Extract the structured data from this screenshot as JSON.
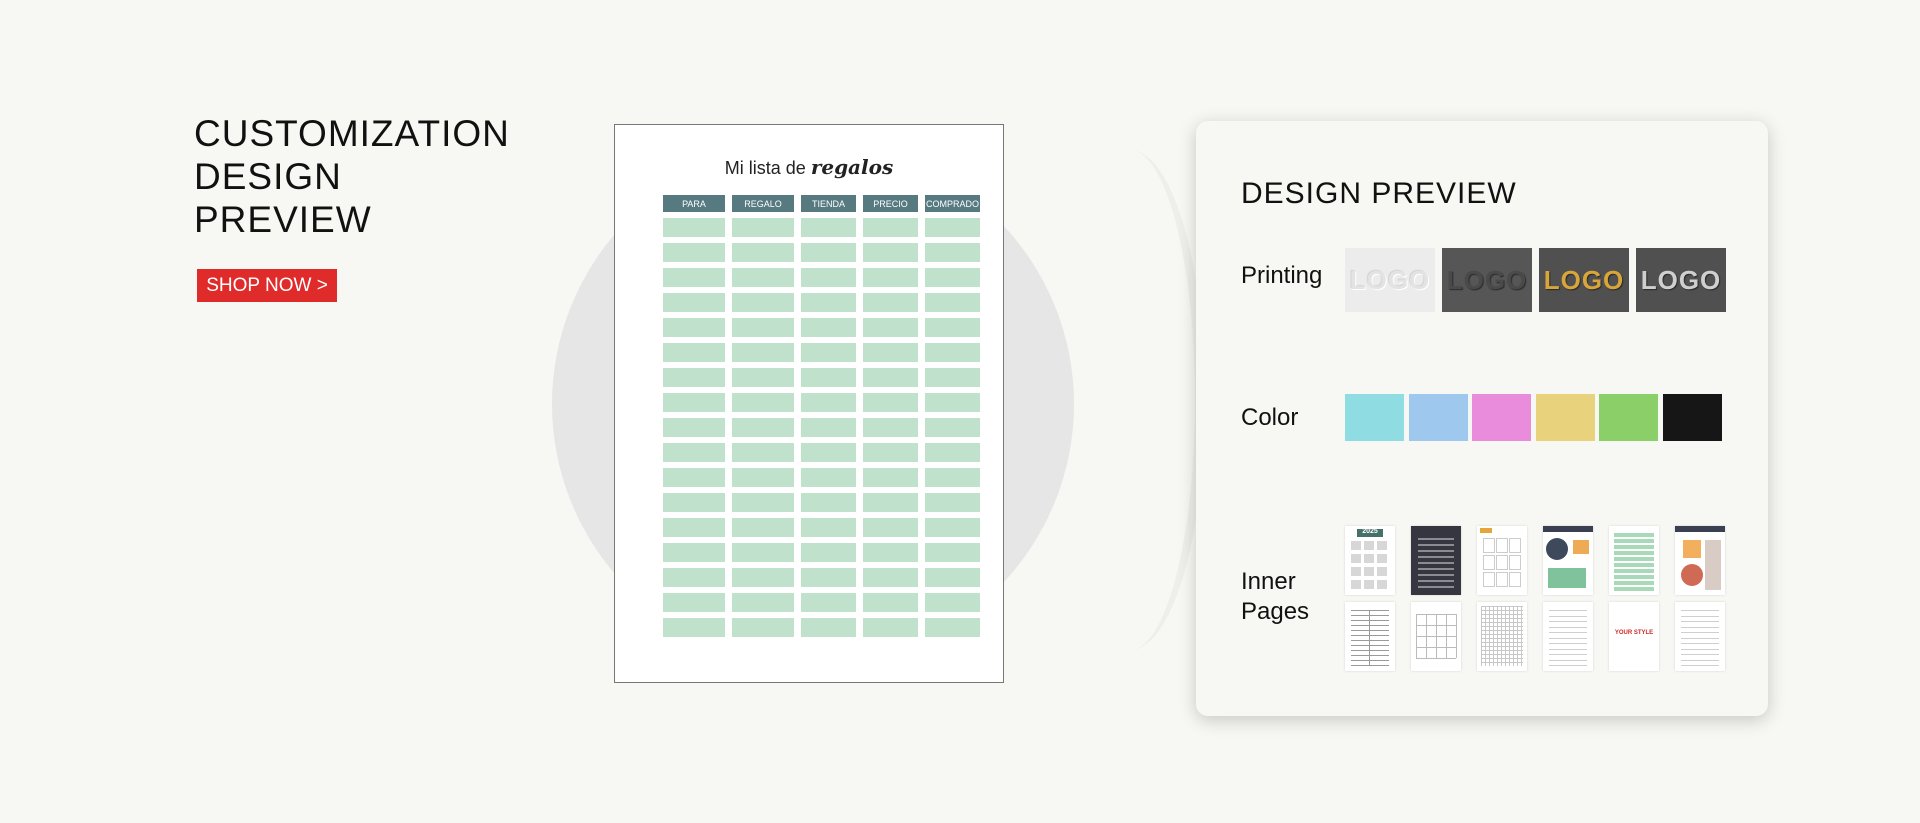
{
  "hero": {
    "headline_lines": [
      "CUSTOMIZATION",
      "DESIGN",
      "PREVIEW"
    ],
    "cta_label": "SHOP NOW >",
    "cta_color": "#e02b2b"
  },
  "document": {
    "title_main": "Mi lista de ",
    "title_script": "regalos",
    "columns": [
      "PARA",
      "REGALO",
      "TIENDA",
      "PRECIO",
      "COMPRADO"
    ],
    "header_color": "#577a80",
    "row_color": "#c0e2cc"
  },
  "panel": {
    "title": "DESIGN PREVIEW",
    "printing_label": "Printing",
    "color_label": "Color",
    "inner_pages_label": [
      "Inner",
      "Pages"
    ],
    "logo_text": "LOGO",
    "logo_variants": [
      {
        "name": "blind-emboss",
        "bg": "#ececec",
        "fg": "#e3e3e3"
      },
      {
        "name": "deboss",
        "bg": "#565656",
        "fg": "#4a4a4a"
      },
      {
        "name": "gold-foil",
        "bg": "#505050",
        "fg": "#d8a53a"
      },
      {
        "name": "silver-foil",
        "bg": "#505050",
        "fg": "#cfcfcf"
      }
    ],
    "colors": [
      "#8fdde2",
      "#9fc8ee",
      "#ea8cdc",
      "#e9d27c",
      "#8bcf69",
      "#161616"
    ],
    "inner_pages": [
      {
        "name": "yearly-calendar-2025",
        "label": "2025"
      },
      {
        "name": "monthly-planner-dark"
      },
      {
        "name": "yearly-grid-orange"
      },
      {
        "name": "vision-board"
      },
      {
        "name": "green-table"
      },
      {
        "name": "collage-page"
      },
      {
        "name": "agenda-list"
      },
      {
        "name": "monthly-calendar"
      },
      {
        "name": "grid-page"
      },
      {
        "name": "lined-page"
      },
      {
        "name": "custom-style",
        "label": "YOUR STYLE"
      },
      {
        "name": "lined-page-2"
      }
    ]
  }
}
